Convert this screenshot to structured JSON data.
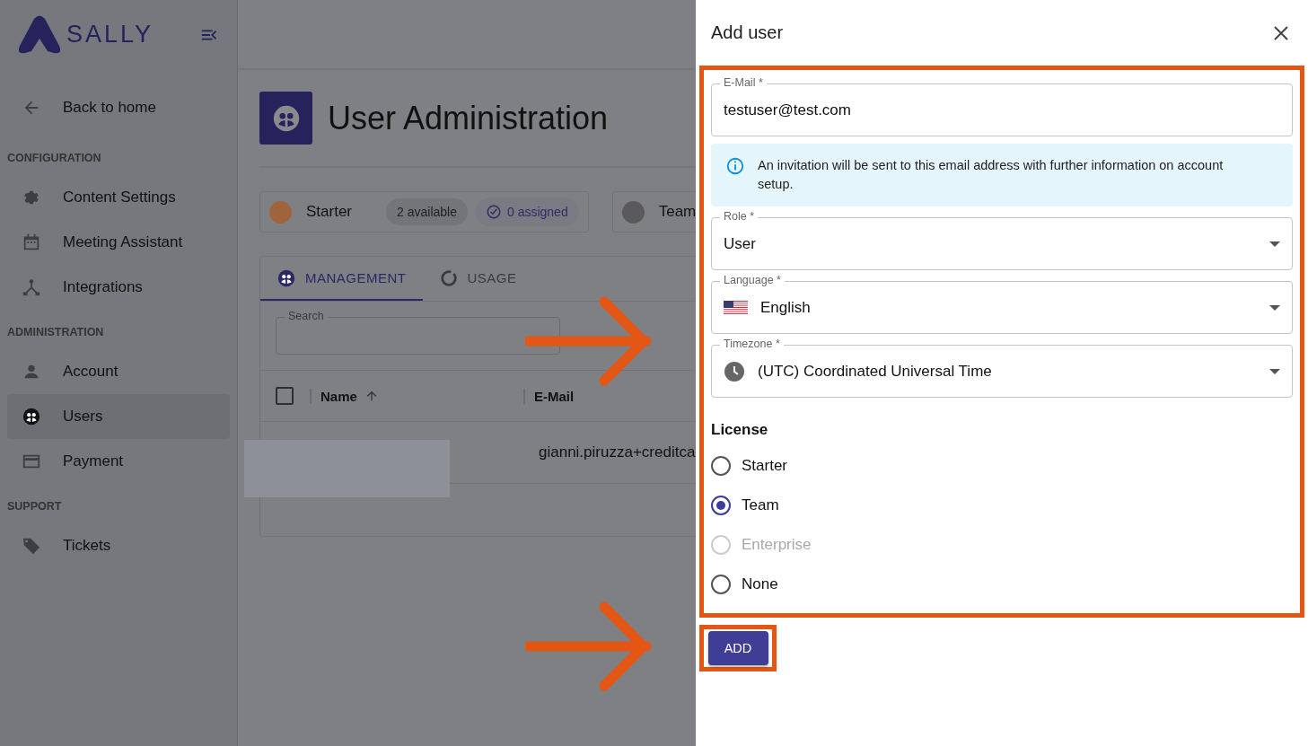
{
  "sidebar": {
    "logo": "SALLY",
    "back": "Back to home",
    "sections": [
      {
        "heading": "CONFIGURATION",
        "items": [
          {
            "label": "Content Settings",
            "selected": false
          },
          {
            "label": "Meeting Assistant",
            "selected": false
          },
          {
            "label": "Integrations",
            "selected": false
          }
        ]
      },
      {
        "heading": "ADMINISTRATION",
        "items": [
          {
            "label": "Account",
            "selected": false
          },
          {
            "label": "Users",
            "selected": true
          },
          {
            "label": "Payment",
            "selected": false
          }
        ]
      },
      {
        "heading": "SUPPORT",
        "items": [
          {
            "label": "Tickets",
            "selected": false
          }
        ]
      }
    ]
  },
  "main": {
    "title": "User Administration",
    "licenses": [
      {
        "name": "Starter",
        "color": "#a0643c",
        "available": "2 available",
        "assigned": "0 assigned"
      },
      {
        "name": "Team",
        "color": "#5a5a5c"
      }
    ],
    "tabs": [
      {
        "label": "MANAGEMENT",
        "selected": true
      },
      {
        "label": "USAGE",
        "selected": false
      }
    ],
    "search": {
      "label": "Search"
    },
    "select_all_checked": false,
    "columns": [
      "Name",
      "E-Mail"
    ],
    "rows": [
      {
        "email": "gianni.piruzza+creditca"
      }
    ]
  },
  "drawer": {
    "title": "Add user",
    "email": {
      "label": "E-Mail *",
      "value": "testuser@test.com"
    },
    "info": "An invitation will be sent to this email address with further information on account setup.",
    "selects": [
      {
        "label": "Role *",
        "value": "User"
      },
      {
        "label": "Language *",
        "value": "English"
      },
      {
        "label": "Timezone *",
        "value": "(UTC) Coordinated Universal Time"
      }
    ],
    "license_heading": "License",
    "options": [
      {
        "label": "Starter",
        "selected": false,
        "disabled": false
      },
      {
        "label": "Team",
        "selected": true,
        "disabled": false
      },
      {
        "label": "Enterprise",
        "selected": false,
        "disabled": true
      },
      {
        "label": "None",
        "selected": false,
        "disabled": false
      }
    ],
    "add": "ADD"
  }
}
